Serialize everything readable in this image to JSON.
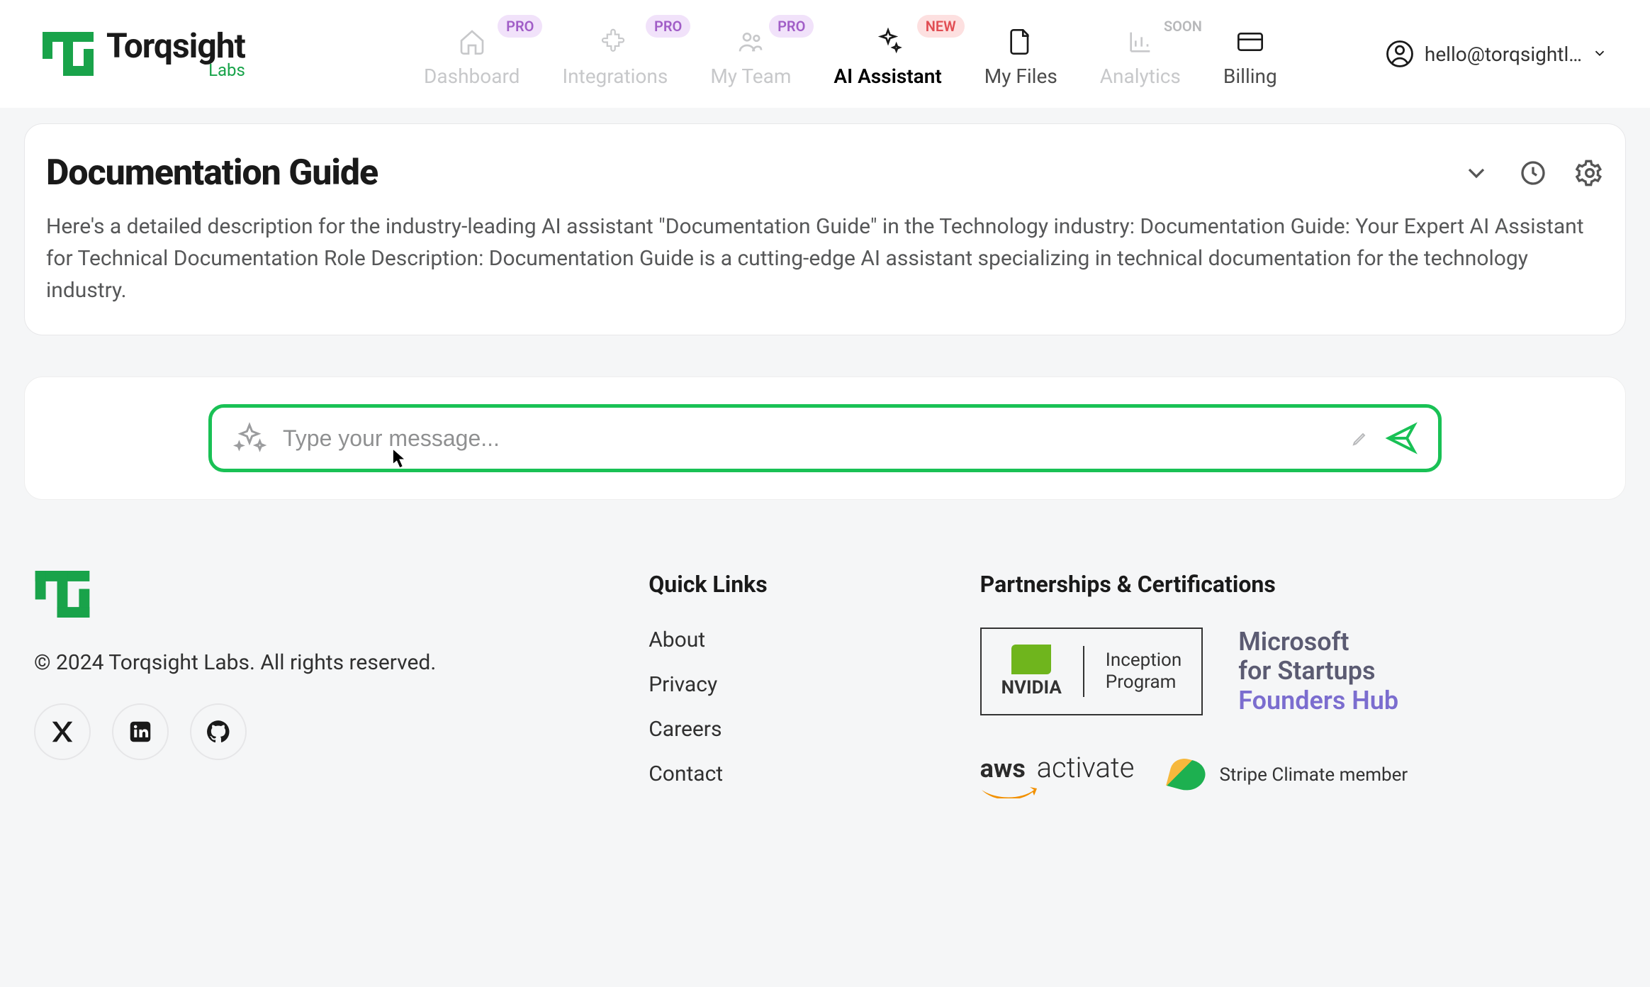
{
  "brand": {
    "name": "Torqsight",
    "sub": "Labs"
  },
  "nav": {
    "dashboard": {
      "label": "Dashboard",
      "badge": "PRO"
    },
    "integrations": {
      "label": "Integrations",
      "badge": "PRO"
    },
    "myteam": {
      "label": "My Team",
      "badge": "PRO"
    },
    "assistant": {
      "label": "AI Assistant",
      "badge": "NEW"
    },
    "myfiles": {
      "label": "My Files"
    },
    "analytics": {
      "label": "Analytics",
      "badge": "SOON"
    },
    "billing": {
      "label": "Billing"
    }
  },
  "user": {
    "email": "hello@torqsightl…"
  },
  "page": {
    "title": "Documentation Guide",
    "description": "Here's a detailed description for the industry-leading AI assistant \"Documentation Guide\" in the Technology industry: Documentation Guide: Your Expert AI Assistant for Technical Documentation Role Description: Documentation Guide is a cutting-edge AI assistant specializing in technical documentation for the technology industry."
  },
  "composer": {
    "placeholder": "Type your message..."
  },
  "footer": {
    "copyright": "© 2024 Torqsight Labs. All rights reserved.",
    "quick_heading": "Quick Links",
    "links": {
      "about": "About",
      "privacy": "Privacy",
      "careers": "Careers",
      "contact": "Contact"
    },
    "partner_heading": "Partnerships & Certifications",
    "nvidia_brand": "NVIDIA",
    "nvidia_program_l1": "Inception",
    "nvidia_program_l2": "Program",
    "ms_l1": "Microsoft",
    "ms_l2": "for Startups",
    "ms_l3": "Founders Hub",
    "aws_brand": "aws",
    "aws_program": "activate",
    "stripe": "Stripe Climate member"
  }
}
